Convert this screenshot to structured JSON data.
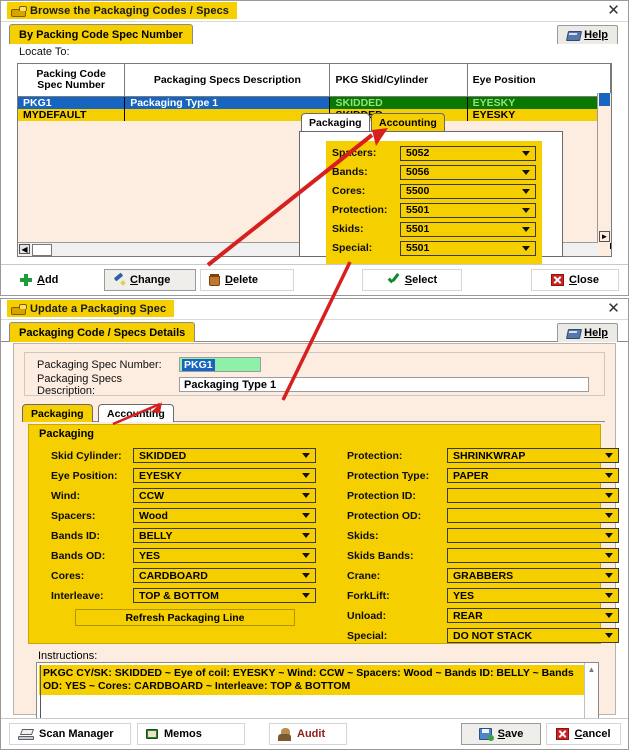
{
  "browse_window": {
    "title": "Browse the Packaging Codes / Specs",
    "close_label": "✕",
    "tab_label": "By Packing Code Spec Number",
    "help_label": "Help",
    "locate_label": "Locate To:",
    "grid": {
      "columns": [
        "Packing Code\nSpec Number",
        "Packaging Specs Description",
        "PKG Skid/Cylinder",
        "Eye Position"
      ],
      "col0_line1": "Packing Code",
      "col0_line2": "Spec Number",
      "col1": "Packaging Specs Description",
      "col2": "PKG Skid/Cylinder",
      "col3": "Eye Position",
      "rows": [
        {
          "code": "PKG1",
          "description": "Packaging Type 1",
          "skid": "SKIDDED",
          "eye": "EYESKY",
          "selected": true
        },
        {
          "code": "MYDEFAULT",
          "description": "",
          "skid": "SKIDDED",
          "eye": "EYESKY",
          "selected": false
        }
      ]
    },
    "buttons": {
      "add": "Add",
      "change": "Change",
      "delete": "Delete",
      "select": "Select",
      "close": "Close"
    }
  },
  "accounting_popup": {
    "tab_inactive": "Packaging",
    "tab_active": "Accounting",
    "fields": [
      {
        "label": "Spacers:",
        "value": "5052"
      },
      {
        "label": "Bands:",
        "value": "5056"
      },
      {
        "label": "Cores:",
        "value": "5500"
      },
      {
        "label": "Protection:",
        "value": "5501"
      },
      {
        "label": "Skids:",
        "value": "5501"
      },
      {
        "label": "Special:",
        "value": "5501"
      }
    ]
  },
  "update_window": {
    "title": "Update a Packaging Spec",
    "close_label": "✕",
    "tab_label": "Packaging Code / Specs Details",
    "help_label": "Help",
    "spec_number_label": "Packaging Spec Number:",
    "spec_number_value": "PKG1",
    "spec_desc_label": "Packaging Specs Description:",
    "spec_desc_value": "Packaging Type 1",
    "tabs": {
      "active": "Packaging",
      "inactive": "Accounting"
    },
    "panel_title": "Packaging",
    "left_fields": [
      {
        "label": "Skid Cylinder:",
        "value": "SKIDDED"
      },
      {
        "label": "Eye Position:",
        "value": "EYESKY"
      },
      {
        "label": "Wind:",
        "value": "CCW"
      },
      {
        "label": "Spacers:",
        "value": "Wood"
      },
      {
        "label": "Bands ID:",
        "value": "BELLY"
      },
      {
        "label": "Bands OD:",
        "value": "YES"
      },
      {
        "label": "Cores:",
        "value": "CARDBOARD"
      },
      {
        "label": "Interleave:",
        "value": "TOP & BOTTOM"
      }
    ],
    "refresh_label": "Refresh Packaging Line",
    "right_fields": [
      {
        "label": "Protection:",
        "value": "SHRINKWRAP"
      },
      {
        "label": "Protection Type:",
        "value": "PAPER"
      },
      {
        "label": "Protection ID:",
        "value": ""
      },
      {
        "label": "Protection OD:",
        "value": ""
      },
      {
        "label": "Skids:",
        "value": ""
      },
      {
        "label": "Skids Bands:",
        "value": ""
      },
      {
        "label": "Crane:",
        "value": "GRABBERS"
      },
      {
        "label": "ForkLift:",
        "value": "YES"
      },
      {
        "label": "Unload:",
        "value": "REAR"
      },
      {
        "label": "Special:",
        "value": "DO NOT STACK"
      }
    ],
    "instructions_label": "Instructions:",
    "instructions_value": "PKGC CY/SK: SKIDDED ~ Eye of coil: EYESKY ~ Wind: CCW ~ Spacers: Wood ~ Bands ID: BELLY ~ Bands OD: YES ~ Cores: CARDBOARD ~ Interleave: TOP & BOTTOM",
    "buttons": {
      "scan_manager": "Scan Manager",
      "memos": "Memos",
      "audit": "Audit",
      "save": "Save",
      "cancel": "Cancel"
    }
  },
  "colors": {
    "accent_yellow": "#f5cf00",
    "selection_blue": "#1765c0",
    "row_green": "#087800",
    "field_green": "#8ff0a8",
    "panel_peach": "#fdece0",
    "arrow_red": "#d81f1f"
  }
}
